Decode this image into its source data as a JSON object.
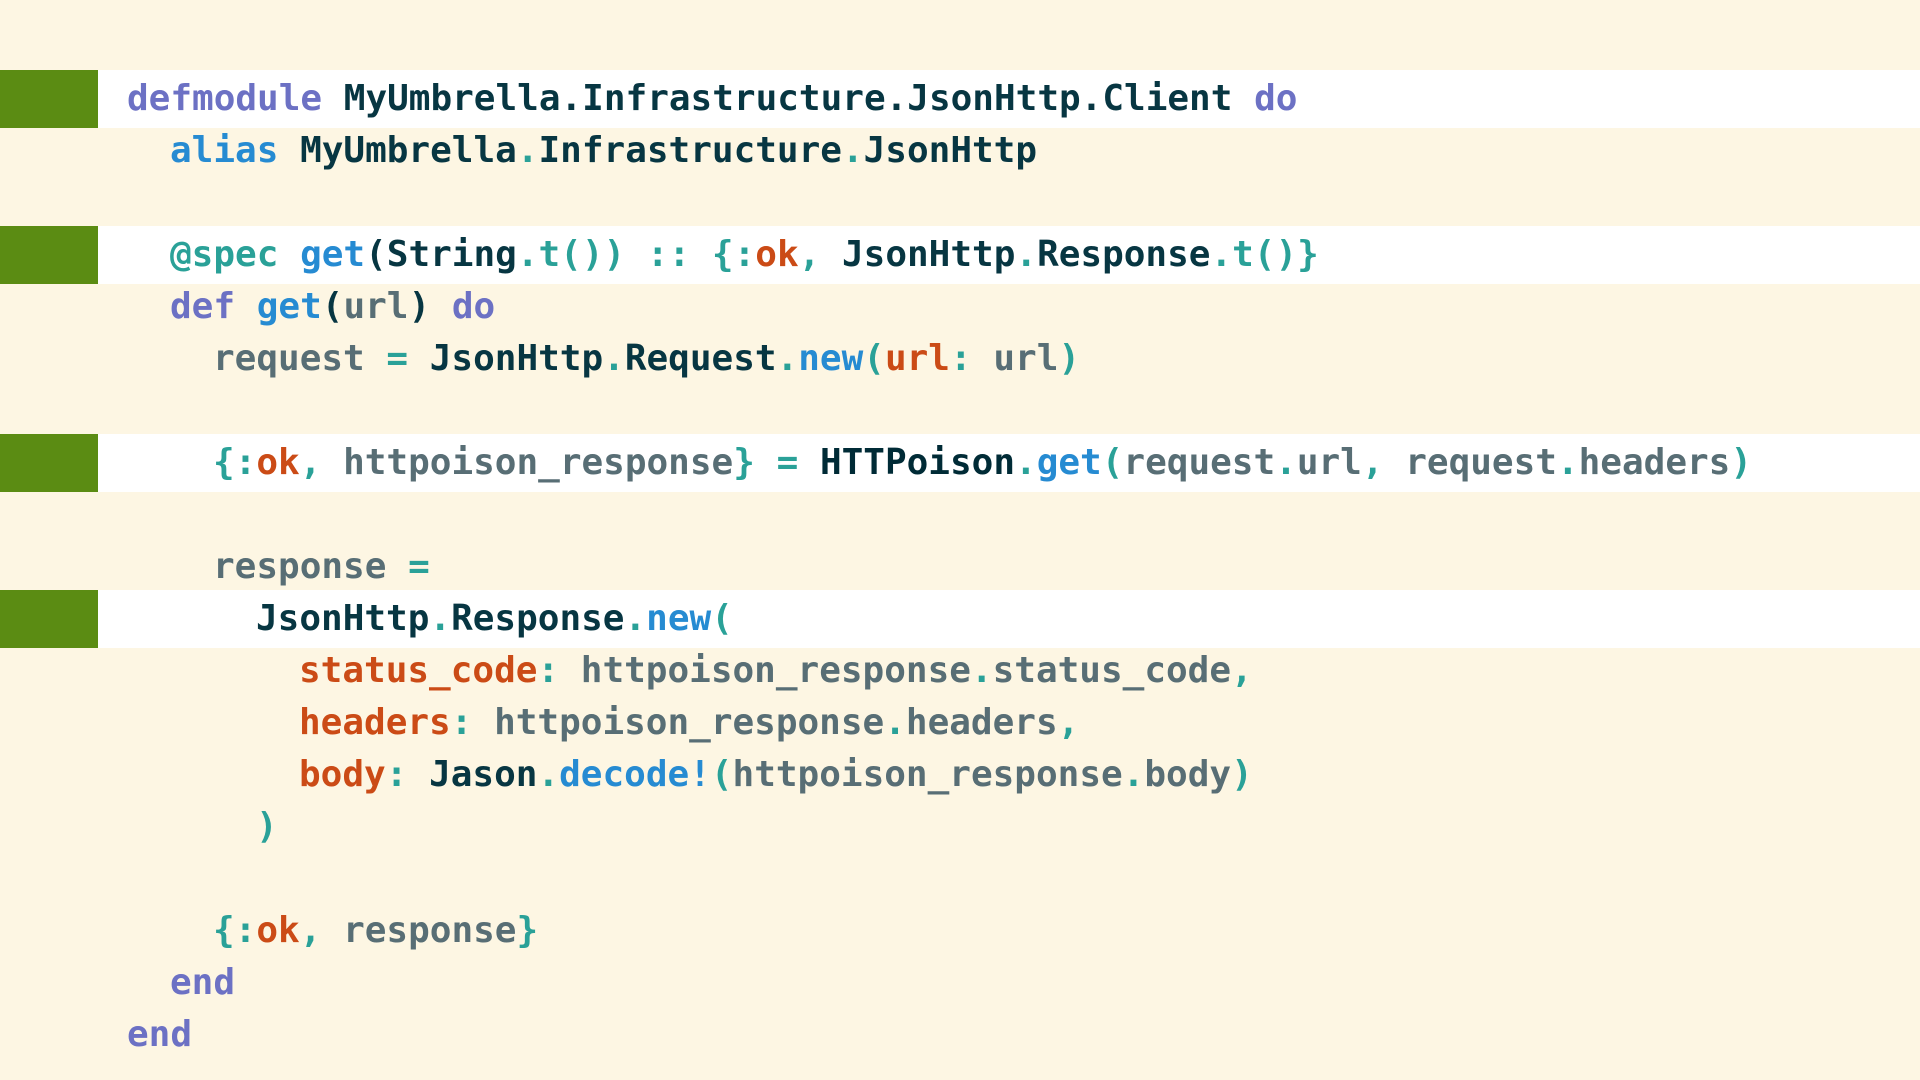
{
  "editor": {
    "lines": [
      {
        "indent": 0,
        "highlighted": true,
        "tokens": [
          {
            "t": "defmodule",
            "k": "kw"
          },
          {
            "t": " ",
            "k": "p"
          },
          {
            "t": "MyUmbrella.Infrastructure.JsonHttp.Client",
            "k": "mod"
          },
          {
            "t": " ",
            "k": "p"
          },
          {
            "t": "do",
            "k": "kw"
          }
        ]
      },
      {
        "indent": 1,
        "highlighted": false,
        "tokens": [
          {
            "t": "alias",
            "k": "fn"
          },
          {
            "t": " ",
            "k": "p"
          },
          {
            "t": "MyUmbrella",
            "k": "mod"
          },
          {
            "t": ".",
            "k": "op"
          },
          {
            "t": "Infrastructure",
            "k": "mod"
          },
          {
            "t": ".",
            "k": "op"
          },
          {
            "t": "JsonHttp",
            "k": "mod"
          }
        ]
      },
      {
        "indent": 0,
        "highlighted": false,
        "tokens": []
      },
      {
        "indent": 1,
        "highlighted": true,
        "tokens": [
          {
            "t": "@spec",
            "k": "op"
          },
          {
            "t": " ",
            "k": "p"
          },
          {
            "t": "get",
            "k": "fn"
          },
          {
            "t": "(",
            "k": "p"
          },
          {
            "t": "String",
            "k": "mod"
          },
          {
            "t": ".t())",
            "k": "op"
          },
          {
            "t": " :: ",
            "k": "op"
          },
          {
            "t": "{:",
            "k": "op"
          },
          {
            "t": "ok",
            "k": "atom"
          },
          {
            "t": ", ",
            "k": "op"
          },
          {
            "t": "JsonHttp",
            "k": "mod"
          },
          {
            "t": ".",
            "k": "op"
          },
          {
            "t": "Response",
            "k": "mod"
          },
          {
            "t": ".t()}",
            "k": "op"
          }
        ]
      },
      {
        "indent": 1,
        "highlighted": false,
        "tokens": [
          {
            "t": "def",
            "k": "kw"
          },
          {
            "t": " ",
            "k": "p"
          },
          {
            "t": "get",
            "k": "fn"
          },
          {
            "t": "(",
            "k": "p"
          },
          {
            "t": "url",
            "k": "var"
          },
          {
            "t": ")",
            "k": "p"
          },
          {
            "t": " ",
            "k": "p"
          },
          {
            "t": "do",
            "k": "kw"
          }
        ]
      },
      {
        "indent": 2,
        "highlighted": false,
        "tokens": [
          {
            "t": "request",
            "k": "var"
          },
          {
            "t": " = ",
            "k": "op"
          },
          {
            "t": "JsonHttp",
            "k": "mod"
          },
          {
            "t": ".",
            "k": "op"
          },
          {
            "t": "Request",
            "k": "mod"
          },
          {
            "t": ".",
            "k": "op"
          },
          {
            "t": "new",
            "k": "fn"
          },
          {
            "t": "(",
            "k": "op"
          },
          {
            "t": "url",
            "k": "atom"
          },
          {
            "t": ": ",
            "k": "op"
          },
          {
            "t": "url",
            "k": "var"
          },
          {
            "t": ")",
            "k": "op"
          }
        ]
      },
      {
        "indent": 0,
        "highlighted": false,
        "tokens": []
      },
      {
        "indent": 2,
        "highlighted": true,
        "tokens": [
          {
            "t": "{:",
            "k": "op"
          },
          {
            "t": "ok",
            "k": "atom"
          },
          {
            "t": ", ",
            "k": "op"
          },
          {
            "t": "httpoison_response",
            "k": "var"
          },
          {
            "t": "}",
            "k": "op"
          },
          {
            "t": " = ",
            "k": "op"
          },
          {
            "t": "HTTPoison",
            "k": "hl"
          },
          {
            "t": ".",
            "k": "op"
          },
          {
            "t": "get",
            "k": "fn"
          },
          {
            "t": "(",
            "k": "op"
          },
          {
            "t": "request",
            "k": "var"
          },
          {
            "t": ".",
            "k": "op"
          },
          {
            "t": "url",
            "k": "var"
          },
          {
            "t": ", ",
            "k": "op"
          },
          {
            "t": "request",
            "k": "var"
          },
          {
            "t": ".",
            "k": "op"
          },
          {
            "t": "headers",
            "k": "var"
          },
          {
            "t": ")",
            "k": "op"
          }
        ]
      },
      {
        "indent": 0,
        "highlighted": false,
        "tokens": []
      },
      {
        "indent": 2,
        "highlighted": false,
        "tokens": [
          {
            "t": "response",
            "k": "var"
          },
          {
            "t": " =",
            "k": "op"
          }
        ]
      },
      {
        "indent": 3,
        "highlighted": true,
        "tokens": [
          {
            "t": "JsonHttp",
            "k": "mod"
          },
          {
            "t": ".",
            "k": "op"
          },
          {
            "t": "Response",
            "k": "mod"
          },
          {
            "t": ".",
            "k": "op"
          },
          {
            "t": "new",
            "k": "fn"
          },
          {
            "t": "(",
            "k": "op"
          }
        ]
      },
      {
        "indent": 4,
        "highlighted": false,
        "tokens": [
          {
            "t": "status_code",
            "k": "atom"
          },
          {
            "t": ": ",
            "k": "op"
          },
          {
            "t": "httpoison_response",
            "k": "var"
          },
          {
            "t": ".",
            "k": "op"
          },
          {
            "t": "status_code",
            "k": "var"
          },
          {
            "t": ",",
            "k": "op"
          }
        ]
      },
      {
        "indent": 4,
        "highlighted": false,
        "tokens": [
          {
            "t": "headers",
            "k": "atom"
          },
          {
            "t": ": ",
            "k": "op"
          },
          {
            "t": "httpoison_response",
            "k": "var"
          },
          {
            "t": ".",
            "k": "op"
          },
          {
            "t": "headers",
            "k": "var"
          },
          {
            "t": ",",
            "k": "op"
          }
        ]
      },
      {
        "indent": 4,
        "highlighted": false,
        "tokens": [
          {
            "t": "body",
            "k": "atom"
          },
          {
            "t": ": ",
            "k": "op"
          },
          {
            "t": "Jason",
            "k": "mod"
          },
          {
            "t": ".",
            "k": "op"
          },
          {
            "t": "decode!",
            "k": "fn"
          },
          {
            "t": "(",
            "k": "op"
          },
          {
            "t": "httpoison_response",
            "k": "var"
          },
          {
            "t": ".",
            "k": "op"
          },
          {
            "t": "body",
            "k": "var"
          },
          {
            "t": ")",
            "k": "op"
          }
        ]
      },
      {
        "indent": 3,
        "highlighted": false,
        "tokens": [
          {
            "t": ")",
            "k": "op"
          }
        ]
      },
      {
        "indent": 0,
        "highlighted": false,
        "tokens": []
      },
      {
        "indent": 2,
        "highlighted": false,
        "tokens": [
          {
            "t": "{:",
            "k": "op"
          },
          {
            "t": "ok",
            "k": "atom"
          },
          {
            "t": ", ",
            "k": "op"
          },
          {
            "t": "response",
            "k": "var"
          },
          {
            "t": "}",
            "k": "op"
          }
        ]
      },
      {
        "indent": 1,
        "highlighted": false,
        "tokens": [
          {
            "t": "end",
            "k": "kw"
          }
        ]
      },
      {
        "indent": 0,
        "highlighted": false,
        "tokens": [
          {
            "t": "end",
            "k": "kw"
          }
        ]
      }
    ]
  }
}
